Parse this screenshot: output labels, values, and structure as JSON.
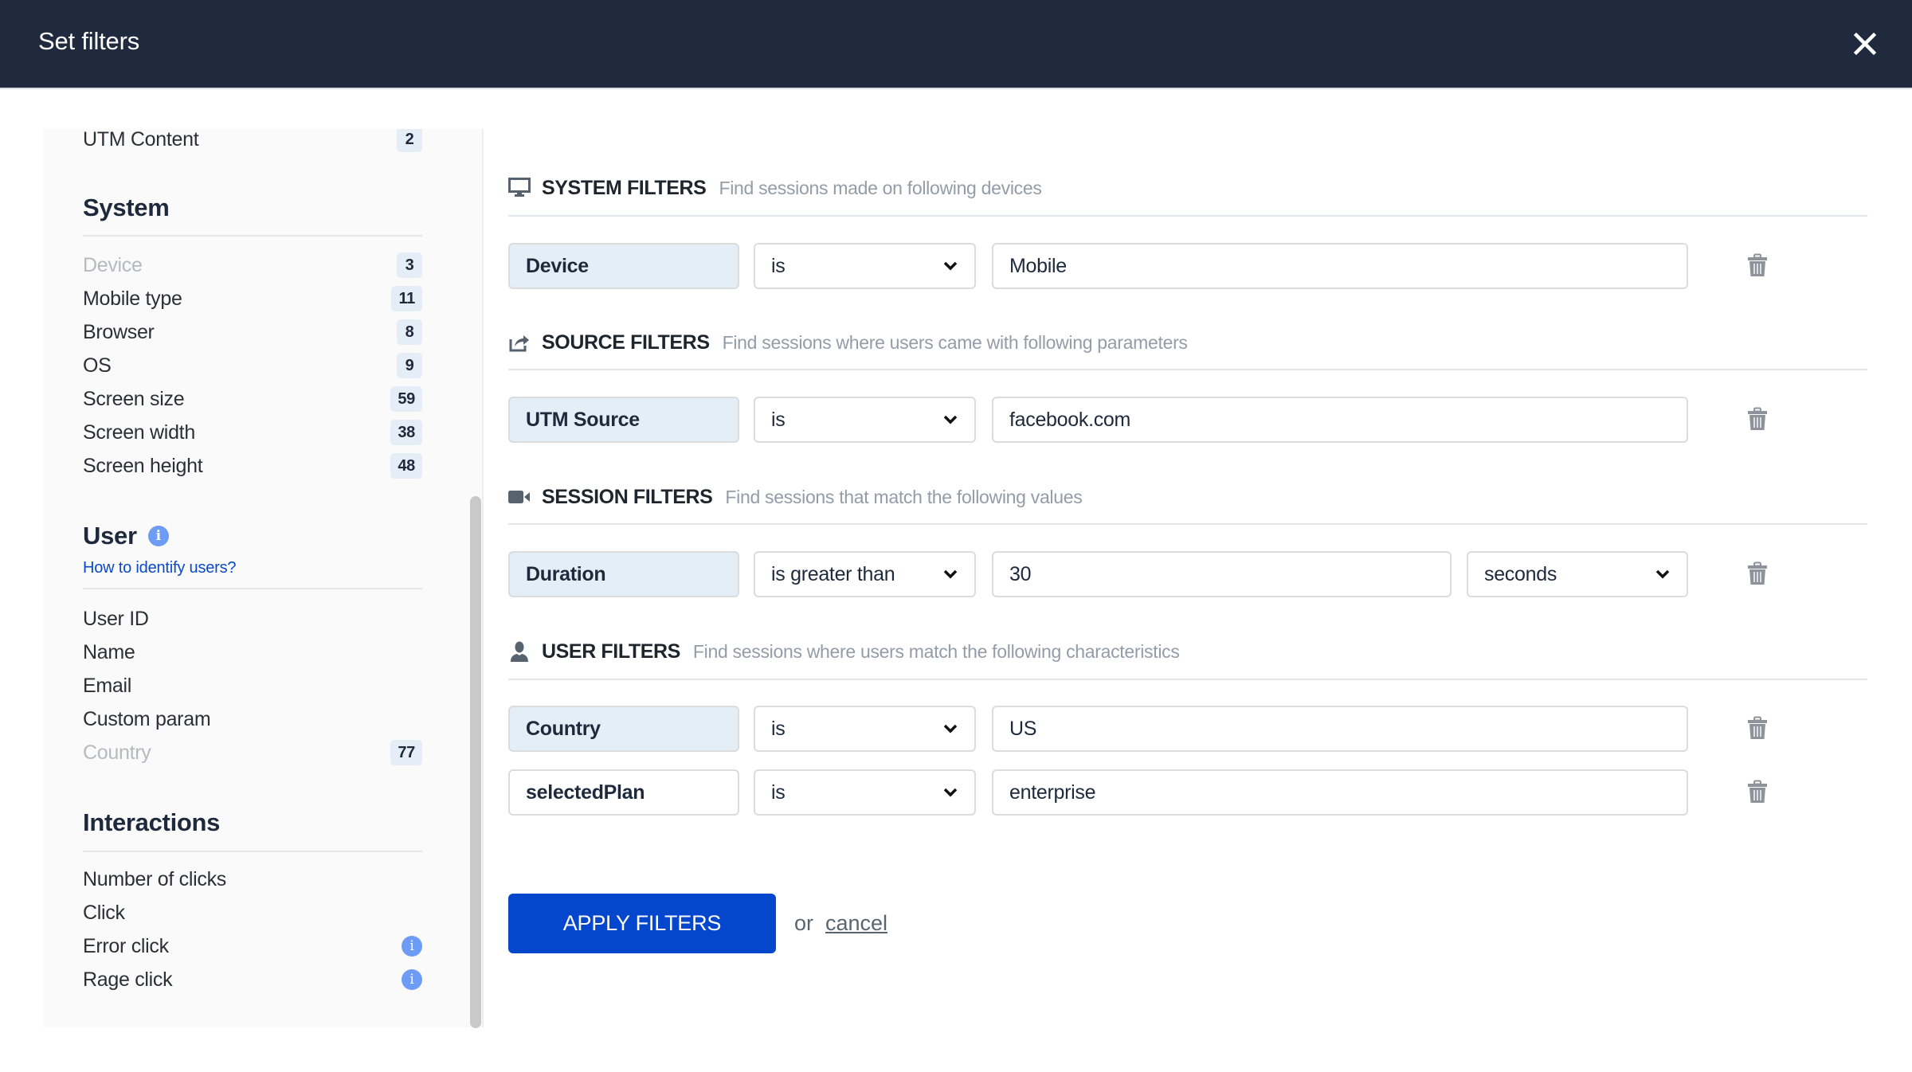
{
  "dialog": {
    "title": "Set filters",
    "close_icon": "close-icon"
  },
  "sidebar": {
    "cut_off_item": {
      "label": "UTM Content",
      "count": "2"
    },
    "sections": [
      {
        "heading": "System",
        "items": [
          {
            "label": "Device",
            "count": "3",
            "muted": true
          },
          {
            "label": "Mobile type",
            "count": "11"
          },
          {
            "label": "Browser",
            "count": "8"
          },
          {
            "label": "OS",
            "count": "9"
          },
          {
            "label": "Screen size",
            "count": "59"
          },
          {
            "label": "Screen width",
            "count": "38"
          },
          {
            "label": "Screen height",
            "count": "48"
          }
        ]
      },
      {
        "heading": "User",
        "info_icon": "info-icon",
        "link": "How to identify users?",
        "items": [
          {
            "label": "User ID"
          },
          {
            "label": "Name"
          },
          {
            "label": "Email"
          },
          {
            "label": "Custom param"
          },
          {
            "label": "Country",
            "count": "77",
            "muted": true
          }
        ]
      },
      {
        "heading": "Interactions",
        "items": [
          {
            "label": "Number of clicks"
          },
          {
            "label": "Click"
          },
          {
            "label": "Error click",
            "info_icon": "info-icon"
          },
          {
            "label": "Rage click",
            "info_icon": "info-icon"
          }
        ]
      }
    ]
  },
  "filters": {
    "system": {
      "icon": "monitor-icon",
      "title": "SYSTEM FILTERS",
      "description": "Find sessions made on following devices",
      "rows": [
        {
          "field": "Device",
          "operator": "is",
          "value": "Mobile"
        }
      ]
    },
    "source": {
      "icon": "share-icon",
      "title": "SOURCE FILTERS",
      "description": "Find sessions where users came with following parameters",
      "rows": [
        {
          "field": "UTM Source",
          "operator": "is",
          "value": "facebook.com"
        }
      ]
    },
    "session": {
      "icon": "video-camera-icon",
      "title": "SESSION FILTERS",
      "description": "Find sessions that match the following values",
      "rows": [
        {
          "field": "Duration",
          "operator": "is greater than",
          "value": "30",
          "unit": "seconds"
        }
      ]
    },
    "user": {
      "icon": "user-icon",
      "title": "USER FILTERS",
      "description": "Find sessions where users match the following characteristics",
      "rows": [
        {
          "field": "Country",
          "operator": "is",
          "value": "US"
        },
        {
          "field": "selectedPlan",
          "operator": "is",
          "value": "enterprise"
        }
      ]
    }
  },
  "actions": {
    "apply_label": "APPLY FILTERS",
    "or_text": "or",
    "cancel_label": "cancel"
  },
  "colors": {
    "header_bg": "#1f2a3e",
    "primary_button": "#0447cc",
    "link": "#0a49c7",
    "field_bg": "#e4eef7",
    "info_icon": "#6d9cf6"
  }
}
